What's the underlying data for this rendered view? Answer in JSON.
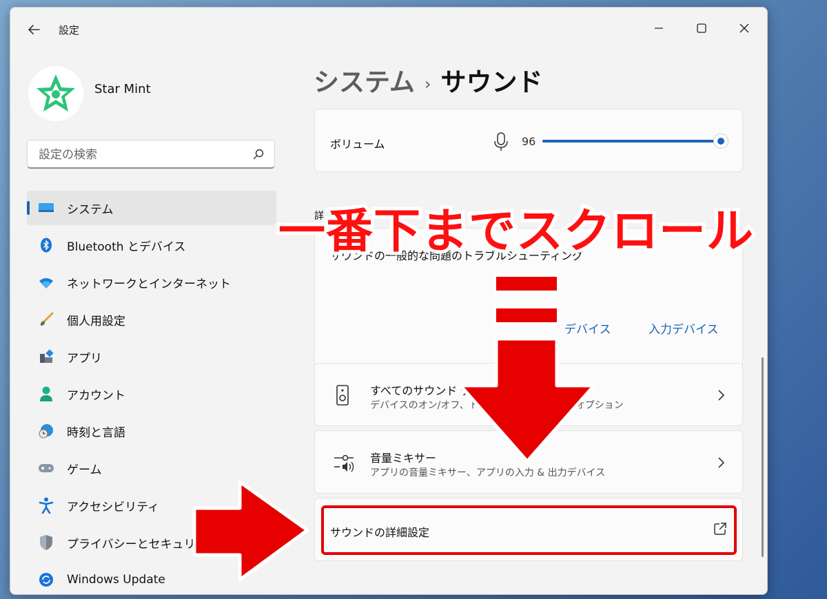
{
  "window": {
    "title": "設定",
    "controls": [
      "minimize",
      "maximize",
      "close"
    ]
  },
  "user": {
    "name": "Star Mint"
  },
  "search": {
    "placeholder": "設定の検索"
  },
  "nav": {
    "items": [
      {
        "label": "システム",
        "icon": "system-icon",
        "active": true
      },
      {
        "label": "Bluetooth とデバイス",
        "icon": "bluetooth-icon"
      },
      {
        "label": "ネットワークとインターネット",
        "icon": "wifi-icon"
      },
      {
        "label": "個人用設定",
        "icon": "brush-icon"
      },
      {
        "label": "アプリ",
        "icon": "apps-icon"
      },
      {
        "label": "アカウント",
        "icon": "account-icon"
      },
      {
        "label": "時刻と言語",
        "icon": "globe-clock-icon"
      },
      {
        "label": "ゲーム",
        "icon": "gamepad-icon"
      },
      {
        "label": "アクセシビリティ",
        "icon": "accessibility-icon"
      },
      {
        "label": "プライバシーとセキュリティ",
        "icon": "shield-icon"
      },
      {
        "label": "Windows Update",
        "icon": "update-icon"
      }
    ]
  },
  "page": {
    "breadcrumb_parent": "システム",
    "breadcrumb_sep": "›",
    "title": "サウンド"
  },
  "volume": {
    "label": "ボリューム",
    "value": "96",
    "level": 0.96
  },
  "advanced": {
    "section_header": "詳",
    "troubleshoot_title": "サウンドの一般的な問題のトラブルシューティング",
    "link_output": "デバイス",
    "link_input": "入力デバイス"
  },
  "rows": {
    "all_devices": {
      "title": "すべてのサウンド デ",
      "subtitle": "デバイスのオン/オフ、トラ　　　　　　　　　オプション"
    },
    "mixer": {
      "title": "音量ミキサー",
      "subtitle": "アプリの音量ミキサー、アプリの入力 & 出力デバイス"
    },
    "advanced_settings": {
      "label": "サウンドの詳細設定"
    }
  },
  "annotation": {
    "banner": "一番下までスクロール",
    "color": "#e60000"
  },
  "colors": {
    "accent": "#1a63b6",
    "annotation_red": "#e60000"
  }
}
